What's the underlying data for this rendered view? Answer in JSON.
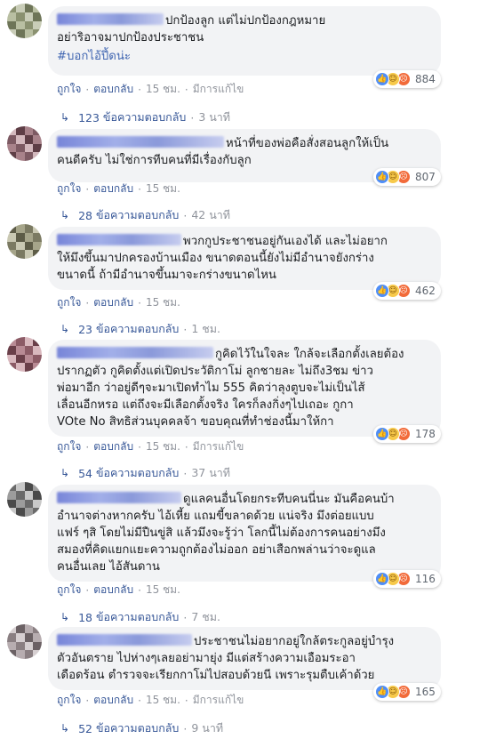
{
  "ui": {
    "like": "ถูกใจ",
    "reply": "ตอบกลับ",
    "edited": "มีการแก้ไข",
    "replies_suffix": "ข้อความตอบกลับ"
  },
  "colors": {
    "link": "#385898",
    "muted": "#90949c",
    "bubble": "#f2f3f5",
    "hashtag": "#4267b2"
  },
  "comments": [
    {
      "text": "ปกป้องลูก แต่ไม่ปกป้องกฎหมาย\nอย่าริอาจมาปกป้องประชาชน",
      "hashtag": "#บอกไอ้ปึ้ดน่ะ",
      "reaction_count": "884",
      "time": "15 ชม.",
      "edited": true,
      "reply_count": "123",
      "reply_time": "3 นาที"
    },
    {
      "text": "หน้าที่ของพ่อคือสั่งสอนลูกให้เป็น\nคนดีครับ ไม่ใช่การทีบคนที่มีเรื่องกับลูก",
      "reaction_count": "807",
      "time": "15 ชม.",
      "edited": false,
      "reply_count": "28",
      "reply_time": "42 นาที"
    },
    {
      "text": "พวกกูประชาชนอยู่กันเองได้ และไม่อยาก\nให้มึงขึ้นมาปกครองบ้านเมือง ขนาดตอนนี้ยังไม่มีอำนาจยังกร่าง\nขนาดนี้ ถ้ามีอำนาจขึ้นมาจะกร่างขนาดไหน",
      "reaction_count": "462",
      "time": "15 ชม.",
      "edited": false,
      "reply_count": "23",
      "reply_time": "1 ชม."
    },
    {
      "text": "กูคิดไว้ในใจละ ใกล้จะเลือกตั้งเลยต้อง\nปรากฏตัว กูคิดตั้งแต่เปิดประวัติกาโม่ ลูกชายละ ไม่ถึง3ชม ข่าว\nพ่อมาอีก ว่าอยู่ดีๆจะมาเปิดทำไม 555 คิดว่าลุงตูบจะไม่เป็นไส้\nเลื่อนอีกหรอ แต่ถึงจะมีเลือกตั้งจริง ใครก็ลงกิ่งๆไปเถอะ กูกา\nVOte No สิทธิส่วนบุคคลจ้า ขอบคุณที่ทำช่องนี้มาให้กา",
      "reaction_count": "178",
      "time": "15 ชม.",
      "edited": true,
      "reply_count": "54",
      "reply_time": "37 นาที"
    },
    {
      "text": "ดูแลคนอื่นโดยกระทีบคนนี่นะ มันคือคนบ้า\nอำนาจต่างหากครับ ไอ้เหี้ย แถมขี้ขลาดด้วย แน่จริง มึงต่อยแบบ\nแฟร์ ๆสิ โดยไม่มีปืนขู่สิ แล้วมึงจะรู้ว่า โลกนี้ไม่ต้องการคนอย่างมึง\nสมองที่คิดแยกแยะความถูกต้องไม่ออก อย่าเสือกพล่านว่าจะดูแล\nคนอื่นเลย ไอ้สันดาน",
      "reaction_count": "116",
      "time": "15 ชม.",
      "edited": false,
      "reply_count": "18",
      "reply_time": "7 ชม."
    },
    {
      "text": "ประชาชนไม่อยากอยู่ใกล้ตระกูลอยู่บำรุง\nตัวอันตราย ไปห่างๆเลยอย่ามายุ่ง มีแต่สร้างความเอือมระอา\nเดือดร้อน ตำรวจจะเรียกกาโม่ไปสอบด้วยนี เพราะรุมตืบเค้าด้วย",
      "reaction_count": "165",
      "time": "15 ชม.",
      "edited": true,
      "reply_count": "52",
      "reply_time": "9 นาที"
    }
  ]
}
